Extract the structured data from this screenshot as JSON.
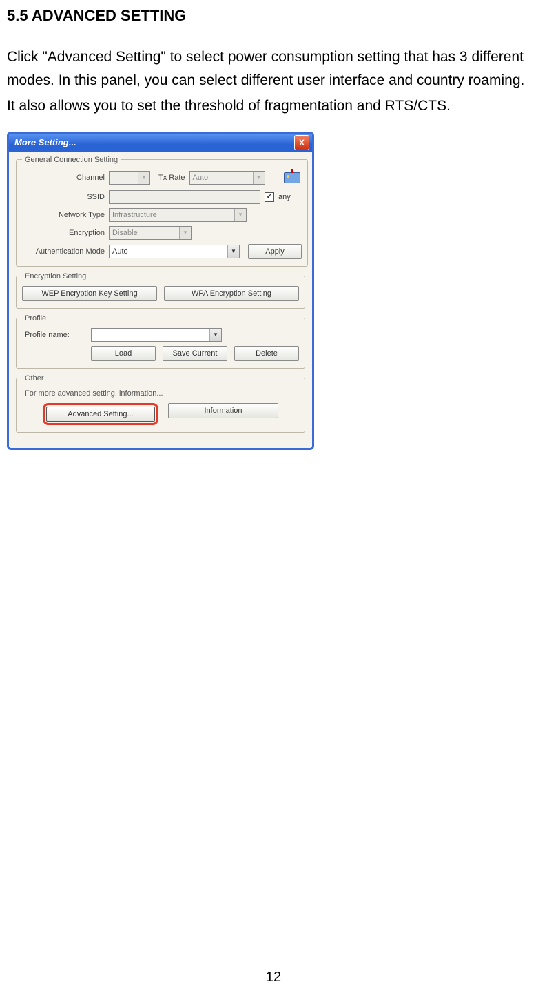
{
  "heading": "5.5 ADVANCED SETTING",
  "paragraph1": "Click \"Advanced Setting\" to select power consumption setting that has 3 different modes. In this panel, you can select different user interface and country roaming.",
  "paragraph2": "It also allows you to set the threshold of fragmentation and RTS/CTS.",
  "window": {
    "title": "More Setting...",
    "close": "X",
    "groups": {
      "general": {
        "legend": "General Connection Setting",
        "channel_label": "Channel",
        "channel_value": "",
        "txrate_label": "Tx Rate",
        "txrate_value": "Auto",
        "ssid_label": "SSID",
        "ssid_value": "",
        "any_label": "any",
        "any_checked": "✓",
        "nettype_label": "Network Type",
        "nettype_value": "Infrastructure",
        "enc_label": "Encryption",
        "enc_value": "Disable",
        "auth_label": "Authentication Mode",
        "auth_value": "Auto",
        "apply_label": "Apply"
      },
      "encryption": {
        "legend": "Encryption Setting",
        "wep_btn": "WEP Encryption Key Setting",
        "wpa_btn": "WPA Encryption Setting"
      },
      "profile": {
        "legend": "Profile",
        "name_label": "Profile name:",
        "name_value": "",
        "load_btn": "Load",
        "save_btn": "Save Current",
        "del_btn": "Delete"
      },
      "other": {
        "legend": "Other",
        "subtext": "For more advanced setting, information...",
        "adv_btn": "Advanced Setting...",
        "info_btn": "Information"
      }
    }
  },
  "page_number": "12"
}
